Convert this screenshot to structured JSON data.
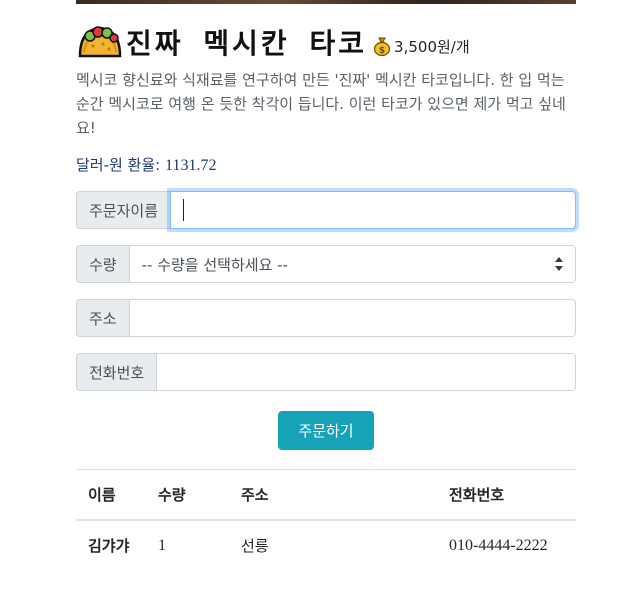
{
  "product": {
    "title": "진짜 멕시칸 타코",
    "price": "3,500원/개",
    "description": "멕시코 향신료와 식재료를 연구하여 만든 '진짜' 멕시칸 타코입니다. 한 입 먹는 순간 멕시코로 여행 온 듯한 착각이 듭니다. 이런 타코가 있으면 제가 먹고 싶네요!",
    "taco_icon": "taco-icon",
    "coin_icon": "money-bag-icon"
  },
  "exchange": {
    "label": "달러-원 환율:",
    "value": "1131.72"
  },
  "form": {
    "name_label": "주문자이름",
    "name_value": "",
    "quantity_label": "수량",
    "quantity_selected": "-- 수량을 선택하세요 --",
    "address_label": "주소",
    "address_value": "",
    "phone_label": "전화번호",
    "phone_value": "",
    "submit_label": "주문하기"
  },
  "orders": {
    "headers": [
      "이름",
      "수량",
      "주소",
      "전화번호"
    ],
    "rows": [
      {
        "name": "김갸갸",
        "quantity": "1",
        "address": "선릉",
        "phone": "010-4444-2222"
      }
    ]
  },
  "colors": {
    "accent": "#17a2b8",
    "focus": "#80bdff",
    "addon_bg": "#e9ecef"
  }
}
